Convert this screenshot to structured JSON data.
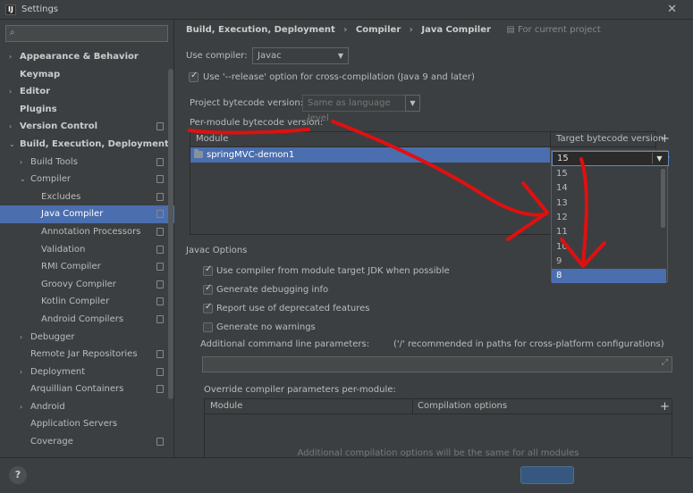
{
  "window": {
    "title": "Settings",
    "app_icon_text": "IJ"
  },
  "sidebar": {
    "search_placeholder": "",
    "items": [
      {
        "label": "Appearance & Behavior",
        "indent": 0,
        "arrow": "›",
        "bold": true
      },
      {
        "label": "Keymap",
        "indent": 0,
        "arrow": "",
        "bold": true
      },
      {
        "label": "Editor",
        "indent": 0,
        "arrow": "›",
        "bold": true
      },
      {
        "label": "Plugins",
        "indent": 0,
        "arrow": "",
        "bold": true
      },
      {
        "label": "Version Control",
        "indent": 0,
        "arrow": "›",
        "bold": true,
        "proj": true
      },
      {
        "label": "Build, Execution, Deployment",
        "indent": 0,
        "arrow": "⌄",
        "bold": true
      },
      {
        "label": "Build Tools",
        "indent": 1,
        "arrow": "›",
        "proj": true
      },
      {
        "label": "Compiler",
        "indent": 1,
        "arrow": "⌄",
        "proj": true
      },
      {
        "label": "Excludes",
        "indent": 2,
        "arrow": "",
        "proj": true
      },
      {
        "label": "Java Compiler",
        "indent": 2,
        "arrow": "",
        "proj": true,
        "selected": true
      },
      {
        "label": "Annotation Processors",
        "indent": 2,
        "arrow": "",
        "proj": true
      },
      {
        "label": "Validation",
        "indent": 2,
        "arrow": "",
        "proj": true
      },
      {
        "label": "RMI Compiler",
        "indent": 2,
        "arrow": "",
        "proj": true
      },
      {
        "label": "Groovy Compiler",
        "indent": 2,
        "arrow": "",
        "proj": true
      },
      {
        "label": "Kotlin Compiler",
        "indent": 2,
        "arrow": "",
        "proj": true
      },
      {
        "label": "Android Compilers",
        "indent": 2,
        "arrow": "",
        "proj": true
      },
      {
        "label": "Debugger",
        "indent": 1,
        "arrow": "›"
      },
      {
        "label": "Remote Jar Repositories",
        "indent": 1,
        "arrow": "",
        "proj": true
      },
      {
        "label": "Deployment",
        "indent": 1,
        "arrow": "›",
        "proj": true
      },
      {
        "label": "Arquillian Containers",
        "indent": 1,
        "arrow": "",
        "proj": true
      },
      {
        "label": "Android",
        "indent": 1,
        "arrow": "›"
      },
      {
        "label": "Application Servers",
        "indent": 1,
        "arrow": ""
      },
      {
        "label": "Coverage",
        "indent": 1,
        "arrow": "",
        "proj": true
      }
    ]
  },
  "breadcrumb": {
    "part1": "Build, Execution, Deployment",
    "part2": "Compiler",
    "part3": "Java Compiler",
    "sep": "›",
    "for_project": "For current project"
  },
  "compiler": {
    "use_compiler_label": "Use compiler:",
    "use_compiler_value": "Javac",
    "release_option_label": "Use '--release' option for cross-compilation (Java 9 and later)",
    "release_option_checked": true,
    "project_bytecode_label": "Project bytecode version:",
    "project_bytecode_value": "Same as language level",
    "per_module_label": "Per-module bytecode version:"
  },
  "module_table": {
    "col_module": "Module",
    "col_target": "Target bytecode version",
    "rows": [
      {
        "module": "springMVC-demon1",
        "target": "15"
      }
    ]
  },
  "version_dropdown": {
    "selected": "15",
    "options": [
      "15",
      "14",
      "13",
      "12",
      "11",
      "10",
      "9",
      "8"
    ],
    "highlighted": "8"
  },
  "javac_options": {
    "title": "Javac Options",
    "checks": [
      {
        "label": "Use compiler from module target JDK when possible",
        "checked": true
      },
      {
        "label": "Generate debugging info",
        "checked": true
      },
      {
        "label": "Report use of deprecated features",
        "checked": true
      },
      {
        "label": "Generate no warnings",
        "checked": false
      }
    ],
    "additional_params_label": "Additional command line parameters:",
    "additional_params_hint": "('/' recommended in paths for cross-platform configurations)",
    "additional_params_value": "",
    "override_label": "Override compiler parameters per-module:"
  },
  "override_table": {
    "col_module": "Module",
    "col_options": "Compilation options",
    "empty_text": "Additional compilation options will be the same for all modules"
  },
  "icons": {
    "search": "search-icon",
    "close": "close-icon",
    "plus": "plus-icon",
    "minus": "minus-icon",
    "folder": "module-folder-icon",
    "help": "help-icon",
    "expand": "expand-icon"
  },
  "colors": {
    "background": "#3c3f41",
    "selection": "#4b6eaf",
    "annotation": "#e01010"
  },
  "footer": {
    "help_label": "?"
  }
}
